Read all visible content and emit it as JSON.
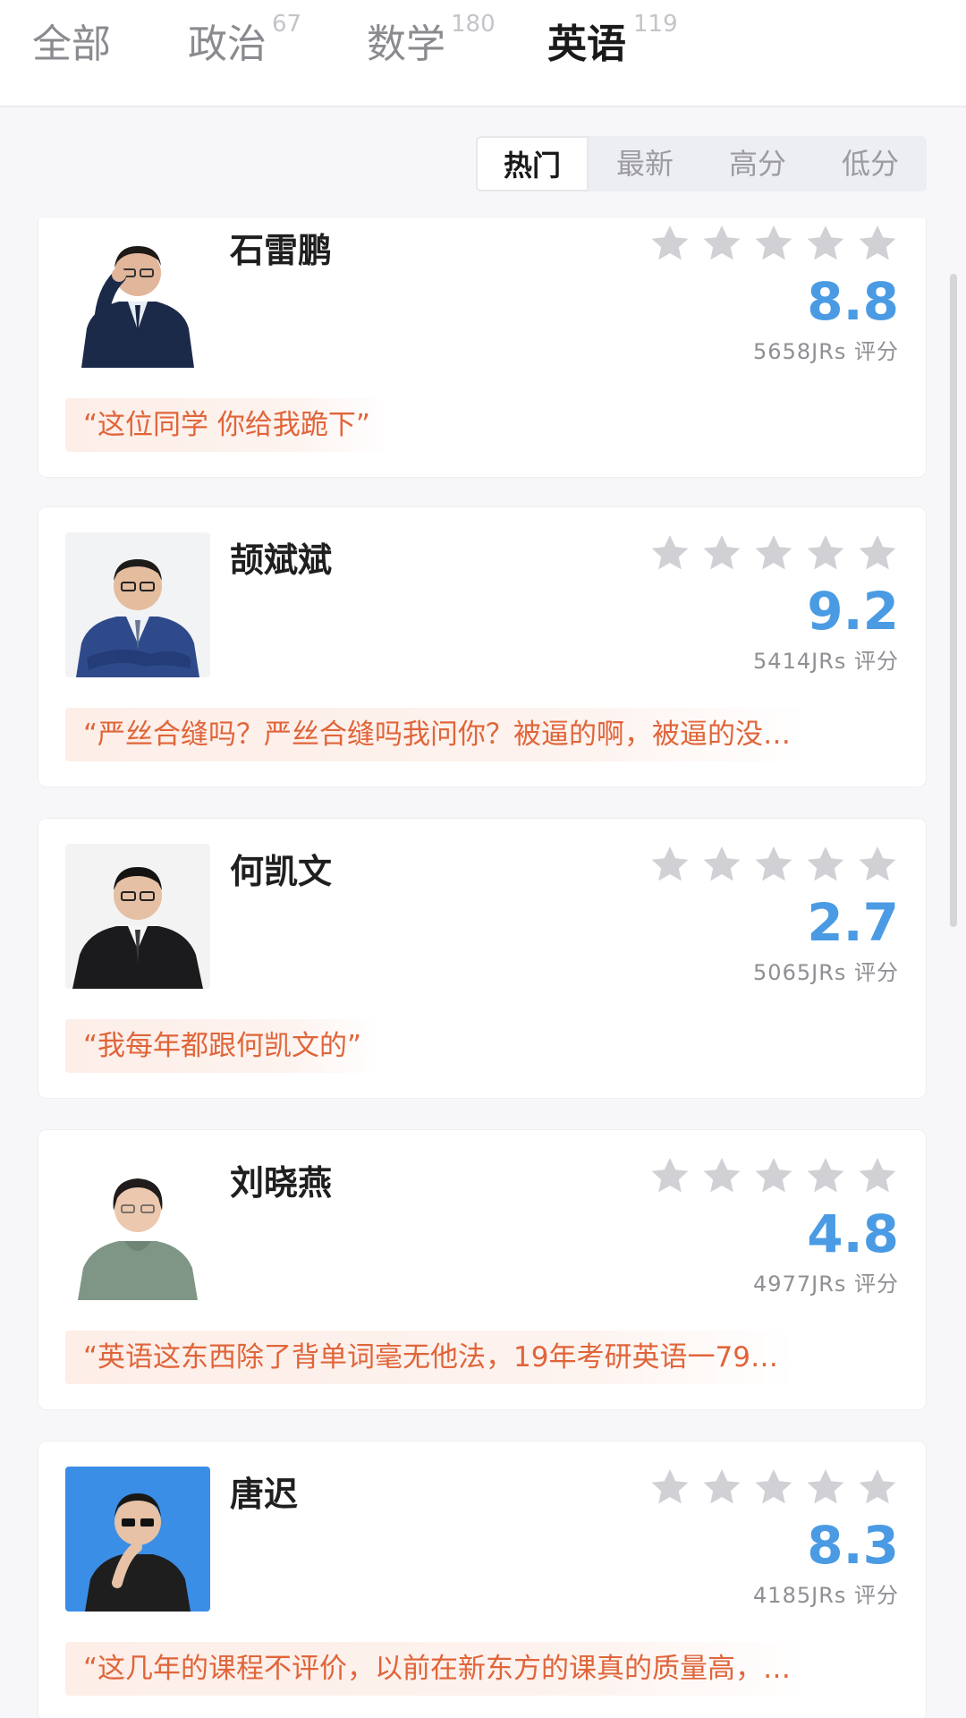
{
  "tabs": [
    {
      "label": "全部",
      "count": ""
    },
    {
      "label": "政治",
      "count": "67"
    },
    {
      "label": "数学",
      "count": "180"
    },
    {
      "label": "英语",
      "count": "119"
    }
  ],
  "sort": [
    "热门",
    "最新",
    "高分",
    "低分"
  ],
  "cards": [
    {
      "name": "石雷鹏",
      "score": "8.8",
      "count": "5658JRs 评分",
      "quote": "“这位同学 你给我跪下”"
    },
    {
      "name": "颉斌斌",
      "score": "9.2",
      "count": "5414JRs 评分",
      "quote": "“严丝合缝吗？严丝合缝吗我问你？被逼的啊，被逼的没…"
    },
    {
      "name": "何凯文",
      "score": "2.7",
      "count": "5065JRs 评分",
      "quote": "“我每年都跟何凯文的”"
    },
    {
      "name": "刘晓燕",
      "score": "4.8",
      "count": "4977JRs 评分",
      "quote": "“英语这东西除了背单词毫无他法，19年考研英语一79…"
    },
    {
      "name": "唐迟",
      "score": "8.3",
      "count": "4185JRs 评分",
      "quote": "“这几年的课程不评价，以前在新东方的课真的质量高，…"
    }
  ],
  "colors": {
    "accent": "#4a9be3",
    "quote": "#e0653a",
    "star": "#d0d0d5"
  }
}
